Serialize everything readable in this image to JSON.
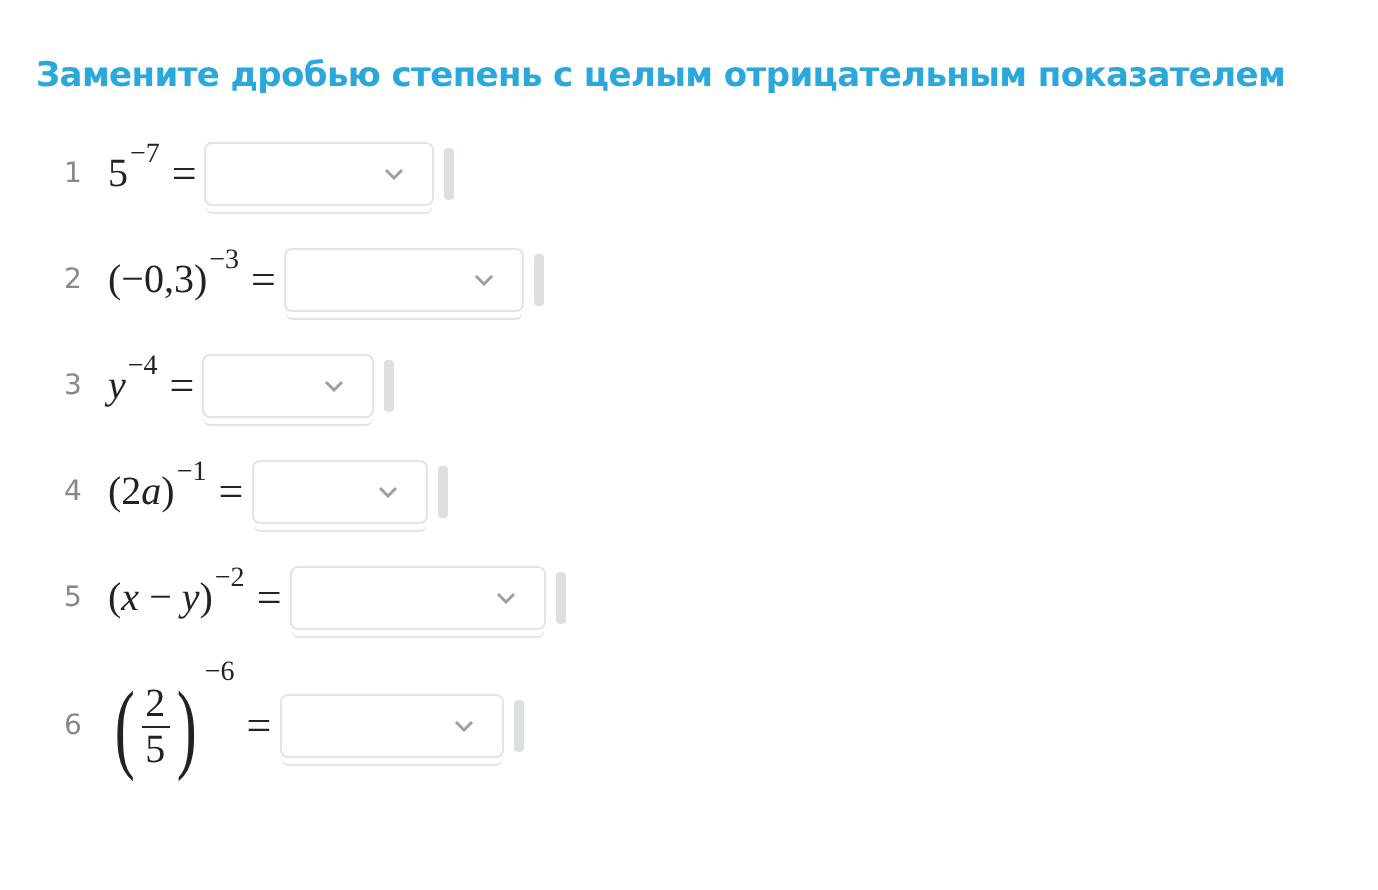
{
  "title": "Замените дробью степень с целым отрицательным показателем",
  "items": [
    {
      "number": "1",
      "kind": "power",
      "base": [
        {
          "text": "5",
          "italic": false
        }
      ],
      "exponent": "−7",
      "equals": "="
    },
    {
      "number": "2",
      "kind": "power",
      "base": [
        {
          "text": "(−0,3)",
          "italic": false
        }
      ],
      "exponent": "−3",
      "equals": "="
    },
    {
      "number": "3",
      "kind": "power",
      "base": [
        {
          "text": "y",
          "italic": true
        }
      ],
      "exponent": "−4",
      "equals": "="
    },
    {
      "number": "4",
      "kind": "power",
      "base": [
        {
          "text": "(2",
          "italic": false
        },
        {
          "text": "a",
          "italic": true
        },
        {
          "text": ")",
          "italic": false
        }
      ],
      "exponent": "−1",
      "equals": "="
    },
    {
      "number": "5",
      "kind": "power",
      "base": [
        {
          "text": "(",
          "italic": false
        },
        {
          "text": "x",
          "italic": true
        },
        {
          "text": " − ",
          "italic": false
        },
        {
          "text": "y",
          "italic": true
        },
        {
          "text": ")",
          "italic": false
        }
      ],
      "exponent": "−2",
      "equals": "="
    },
    {
      "number": "6",
      "kind": "fraction",
      "open": "(",
      "numerator": "2",
      "denominator": "5",
      "close": ")",
      "exponent": "−6",
      "equals": "="
    }
  ]
}
